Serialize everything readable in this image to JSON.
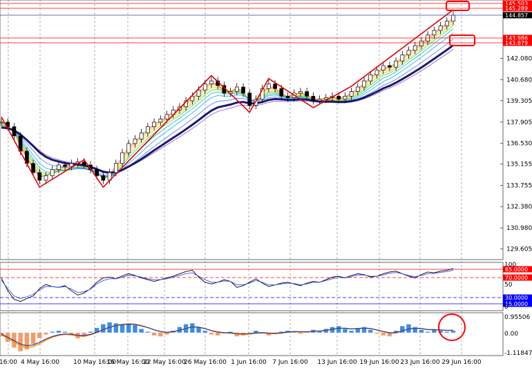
{
  "chart_data": [
    {
      "type": "candlestick",
      "yticks": [
        "142.080",
        "140.680",
        "139.305",
        "137.905",
        "136.530",
        "135.155",
        "133.755",
        "132.380",
        "130.980",
        "129.605"
      ],
      "xticks": [
        "16:00",
        "4 May 16:00",
        "10 May 16:00",
        "16 May 16:00",
        "22 May 16:00",
        "26 May 16:00",
        "1 Jun 16:00",
        "7 Jun 16:00",
        "13 Jun 16:00",
        "19 Jun 16:00",
        "23 Jun 16:00",
        "29 Jun 16:00"
      ],
      "price_labels": [
        {
          "text": "145.503",
          "color": "#ff0000"
        },
        {
          "text": "145.289",
          "color": "#ff0000"
        },
        {
          "text": "144.857",
          "color": "#000000"
        },
        {
          "text": "143.986",
          "color": "#ff0000"
        },
        {
          "text": "143.879",
          "color": "#ff0000"
        }
      ],
      "ylim": [
        129.0,
        145.8
      ],
      "close_series": [
        137.9,
        137.6,
        137.0,
        136.0,
        135.2,
        134.6,
        134.1,
        134.4,
        134.8,
        135.1,
        135.0,
        135.2,
        135.3,
        135.1,
        134.8,
        134.4,
        134.1,
        134.6,
        135.2,
        135.9,
        136.5,
        136.8,
        137.2,
        137.6,
        137.9,
        138.1,
        138.4,
        138.7,
        138.9,
        139.3,
        139.6,
        140.0,
        140.4,
        140.6,
        140.3,
        139.8,
        139.9,
        140.2,
        139.8,
        139.0,
        139.4,
        140.1,
        140.4,
        140.1,
        139.6,
        139.5,
        139.8,
        139.9,
        139.6,
        139.3,
        139.4,
        139.5,
        139.6,
        139.4,
        139.6,
        139.9,
        140.2,
        140.6,
        141.0,
        141.3,
        141.6,
        141.5,
        141.9,
        142.3,
        142.6,
        142.9,
        143.2,
        143.6,
        143.9,
        144.2,
        144.5,
        144.9
      ]
    },
    {
      "type": "line",
      "title": "",
      "ylim": [
        0,
        100
      ],
      "level_labels": [
        {
          "text": "85.0000",
          "color": "#ff0000"
        },
        {
          "text": "70.0000",
          "color": "#ff0000"
        },
        {
          "text": "30.0000",
          "color": "#0000ff"
        },
        {
          "text": "15.0000",
          "color": "#0000ff"
        }
      ],
      "axis_labels": [
        "100",
        "50",
        "0"
      ],
      "series": [
        {
          "values": [
            70,
            40,
            20,
            15,
            22,
            28,
            45,
            55,
            50,
            48,
            52,
            40,
            30,
            35,
            45,
            60,
            70,
            72,
            68,
            75,
            80,
            76,
            70,
            66,
            62,
            66,
            70,
            74,
            80,
            85,
            88,
            72,
            60,
            56,
            60,
            66,
            62,
            48,
            52,
            60,
            68,
            58,
            50,
            54,
            58,
            60,
            56,
            52,
            58,
            62,
            60,
            66,
            72,
            74,
            70,
            76,
            80,
            78,
            72,
            74,
            80,
            84,
            86,
            80,
            74,
            70,
            78,
            84,
            82,
            86,
            88,
            92
          ]
        },
        {
          "values": [
            65,
            45,
            28,
            22,
            26,
            32,
            42,
            50,
            50,
            48,
            50,
            44,
            36,
            38,
            44,
            56,
            64,
            68,
            68,
            72,
            76,
            75,
            72,
            68,
            66,
            66,
            68,
            72,
            76,
            80,
            82,
            74,
            66,
            60,
            60,
            63,
            62,
            54,
            54,
            58,
            64,
            60,
            54,
            54,
            56,
            58,
            57,
            54,
            56,
            60,
            60,
            64,
            68,
            71,
            70,
            73,
            77,
            77,
            74,
            74,
            77,
            81,
            83,
            80,
            76,
            73,
            76,
            80,
            81,
            83,
            85,
            88
          ]
        }
      ]
    },
    {
      "type": "bar",
      "ylabels": [
        "0.95506",
        "0.00",
        "-1.11847"
      ],
      "ylim": [
        -1.11847,
        0.95506
      ],
      "histogram": [
        -0.2,
        -0.5,
        -0.8,
        -1.0,
        -0.9,
        -0.6,
        -0.3,
        -0.1,
        0.05,
        0.1,
        0.05,
        -0.1,
        -0.3,
        -0.2,
        0.05,
        0.25,
        0.45,
        0.55,
        0.5,
        0.45,
        0.5,
        0.4,
        0.2,
        0.05,
        -0.15,
        -0.2,
        -0.1,
        0.1,
        0.3,
        0.45,
        0.5,
        0.3,
        0.1,
        -0.1,
        -0.15,
        0.0,
        0.05,
        -0.2,
        -0.15,
        -0.05,
        0.1,
        0.0,
        -0.15,
        -0.05,
        0.05,
        0.1,
        0.05,
        -0.05,
        0.05,
        0.15,
        0.1,
        0.2,
        0.3,
        0.35,
        0.2,
        0.1,
        0.25,
        0.3,
        0.15,
        -0.05,
        -0.15,
        -0.2,
        0.1,
        0.35,
        0.45,
        0.3,
        0.15,
        0.05,
        0.15,
        0.1,
        0.05,
        0.1
      ],
      "signal": [
        -0.1,
        -0.3,
        -0.5,
        -0.7,
        -0.8,
        -0.75,
        -0.6,
        -0.4,
        -0.25,
        -0.15,
        -0.1,
        -0.12,
        -0.18,
        -0.2,
        -0.12,
        0.0,
        0.15,
        0.3,
        0.4,
        0.45,
        0.48,
        0.46,
        0.38,
        0.28,
        0.15,
        0.05,
        0.0,
        0.04,
        0.12,
        0.22,
        0.32,
        0.3,
        0.22,
        0.1,
        0.02,
        -0.02,
        -0.03,
        -0.08,
        -0.1,
        -0.08,
        -0.03,
        -0.02,
        -0.05,
        -0.06,
        -0.03,
        0.02,
        0.04,
        0.03,
        0.03,
        0.06,
        0.08,
        0.12,
        0.18,
        0.24,
        0.24,
        0.2,
        0.22,
        0.25,
        0.22,
        0.14,
        0.05,
        -0.03,
        -0.02,
        0.08,
        0.2,
        0.24,
        0.22,
        0.16,
        0.16,
        0.14,
        0.12,
        0.12
      ]
    }
  ]
}
